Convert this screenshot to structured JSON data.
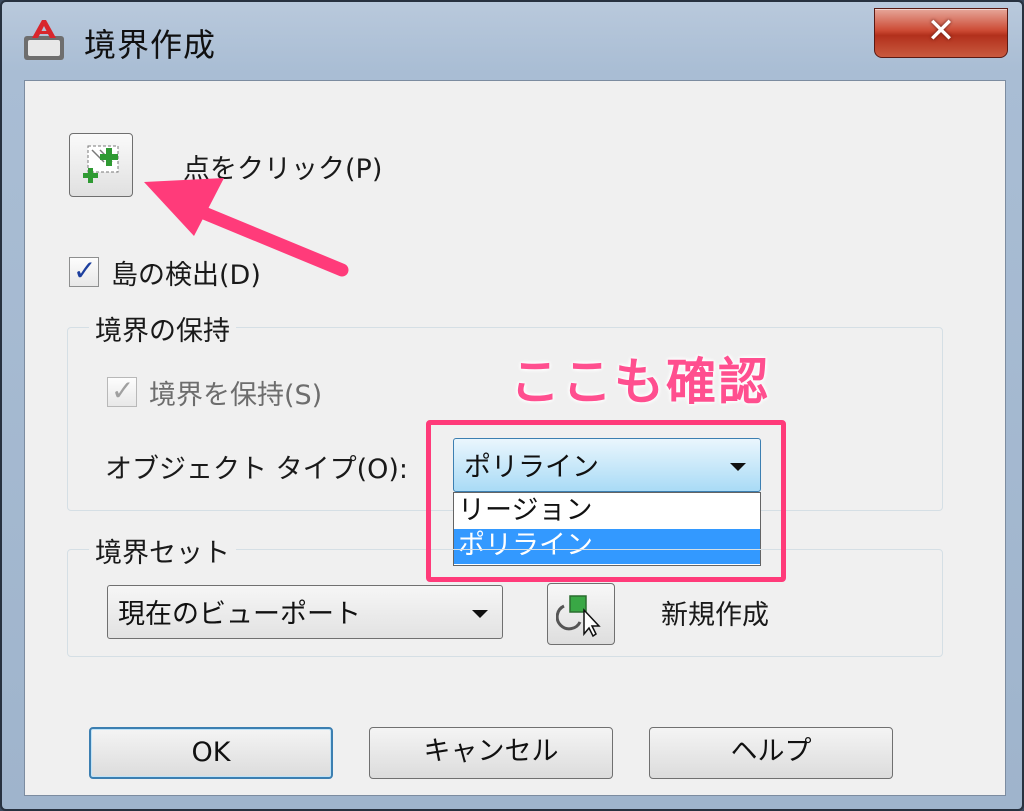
{
  "window": {
    "title": "境界作成",
    "close_label": "✕"
  },
  "pick_points": {
    "label": "点をクリック(P)"
  },
  "island_detection": {
    "label": "島の検出(D)",
    "checked": true
  },
  "retain_boundary": {
    "group_label": "境界の保持",
    "checkbox_label": "境界を保持(S)",
    "object_type_label": "オブジェクト タイプ(O):",
    "object_type_value": "ポリライン",
    "options": [
      "リージョン",
      "ポリライン"
    ],
    "selected_option": "ポリライン"
  },
  "boundary_set": {
    "group_label": "境界セット",
    "combo_value": "現在のビューポート",
    "new_label": "新規作成"
  },
  "buttons": {
    "ok": "OK",
    "cancel": "キャンセル",
    "help": "ヘルプ"
  },
  "annotation": {
    "text": "ここも確認",
    "color": "#ff4f8f"
  },
  "colors": {
    "highlight": "#ff3b7a",
    "selection": "#3399ff",
    "close_button": "#c9432d"
  }
}
